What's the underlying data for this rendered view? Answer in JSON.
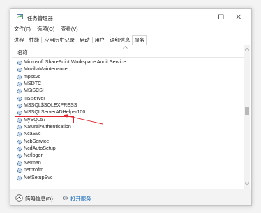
{
  "window": {
    "title": "任务管理器",
    "controls": [
      "minimize-icon",
      "maximize-icon",
      "close-icon"
    ]
  },
  "menu": [
    "文件(F)",
    "选项(O)",
    "查看(V)"
  ],
  "tabs": [
    "进程",
    "性能",
    "应用历史记录",
    "启动",
    "用户",
    "详细信息",
    "服务"
  ],
  "active_tab": "服务",
  "column_header": "名称",
  "services": [
    {
      "name": "Microsoft SharePoint Workspace Audit Service"
    },
    {
      "name": "MozillaMaintenance"
    },
    {
      "name": "mpssvc"
    },
    {
      "name": "MSDTC"
    },
    {
      "name": "MSiSCSI"
    },
    {
      "name": "msiserver"
    },
    {
      "name": "MSSQL$SQLEXPRESS"
    },
    {
      "name": "MSSQLServerADHelper100"
    },
    {
      "name": "MySQL57",
      "highlighted": true
    },
    {
      "name": "NaturalAuthentication"
    },
    {
      "name": "NcaSvc"
    },
    {
      "name": "NcbService"
    },
    {
      "name": "NcdAutoSetup"
    },
    {
      "name": "Netlogon"
    },
    {
      "name": "Netman"
    },
    {
      "name": "netprofm"
    },
    {
      "name": "NetSetupSvc"
    }
  ],
  "footer": {
    "fewer_details": "简略信息(D)",
    "open_services": "打开服务"
  },
  "colors": {
    "highlight_box": "#e0252f",
    "link": "#0e66c2",
    "service_icon": "#5a86b8"
  }
}
